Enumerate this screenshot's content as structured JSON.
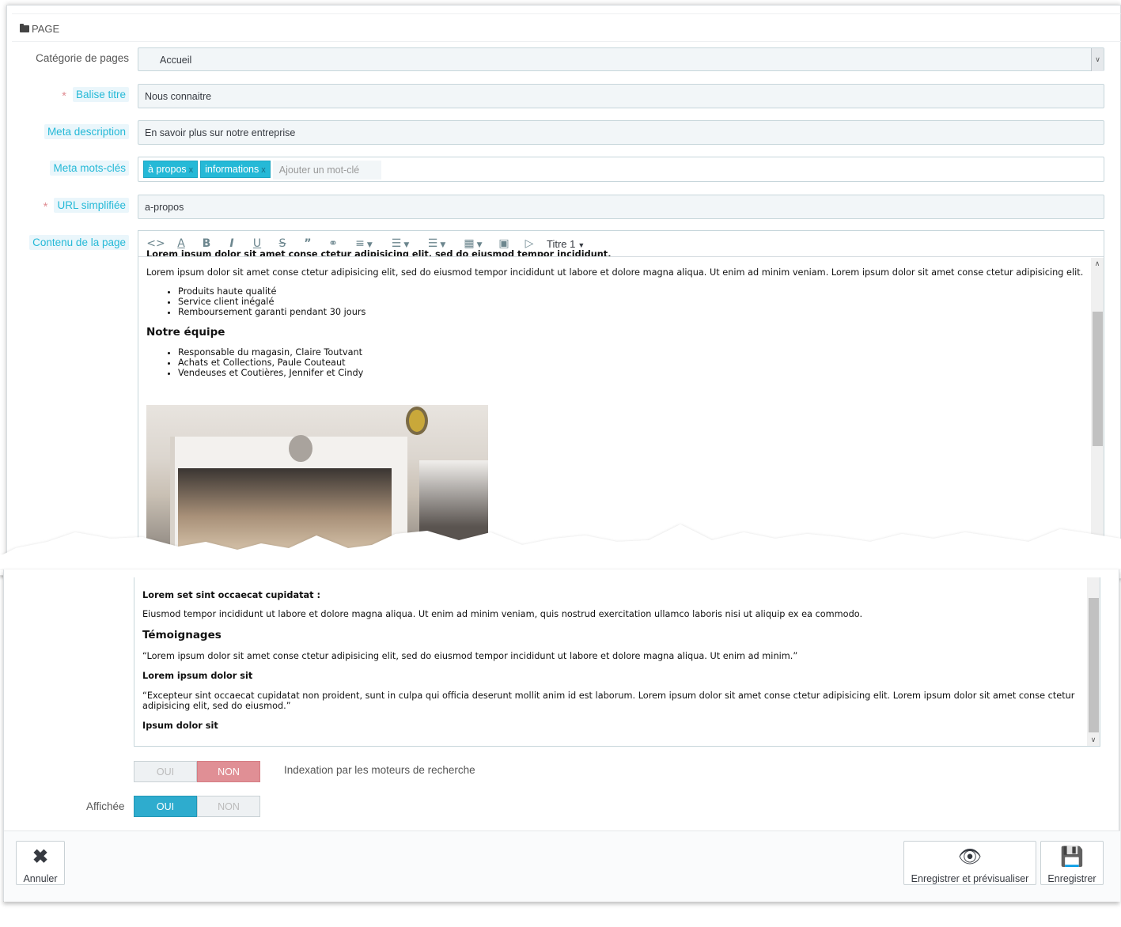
{
  "panel": {
    "title": "PAGE"
  },
  "form": {
    "category_label": "Catégorie de pages",
    "category_value": "Accueil",
    "title_tag_label": "Balise titre",
    "title_tag_value": "Nous connaitre",
    "meta_description_label": "Meta description",
    "meta_description_value": "En savoir plus sur notre entreprise",
    "meta_keywords_label": "Meta mots-clés",
    "keywords": [
      "à propos",
      "informations"
    ],
    "keyword_placeholder": "Ajouter un mot-clé",
    "url_label": "URL simplifiée",
    "url_value": "a-propos",
    "content_label": "Contenu de la page",
    "required_mark": "*"
  },
  "toolbar": {
    "icons": [
      "code-view-icon",
      "text-color-icon",
      "bold-icon",
      "italic-icon",
      "underline-icon",
      "strikethrough-icon",
      "quote-icon",
      "link-icon",
      "align-icon",
      "bullet-list-icon",
      "numbered-list-icon",
      "table-icon",
      "image-icon",
      "video-icon"
    ],
    "heading_select": "Titre 1"
  },
  "content_top": {
    "cut_line": "Lorem ipsum dolor sit amet conse ctetur adipisicing elit, sed do eiusmod tempor incididunt.",
    "paragraph": "Lorem ipsum dolor sit amet conse ctetur adipisicing elit, sed do eiusmod tempor incididunt ut labore et dolore magna aliqua. Ut enim ad minim veniam. Lorem ipsum dolor sit amet conse ctetur adipisicing elit.",
    "list1": [
      "Produits haute qualité",
      "Service client inégalé",
      "Remboursement garanti pendant 30 jours"
    ],
    "heading_team": "Notre équipe",
    "list2": [
      "Responsable du magasin, Claire Toutvant",
      "Achats et Collections, Paule Couteaut",
      "Vendeuses et Coutières, Jennifer et Cindy"
    ]
  },
  "content_bottom": {
    "cut_heading": "Lorem set sint occaecat cupidatat :",
    "paragraph": "Eiusmod tempor incididunt ut labore et dolore magna aliqua. Ut enim ad minim veniam, quis nostrud exercitation ullamco laboris nisi ut aliquip ex ea commodo.",
    "heading_testimonials": "Témoignages",
    "quote1": "“Lorem ipsum dolor sit amet conse ctetur adipisicing elit, sed do eiusmod tempor incididunt ut labore et dolore magna aliqua. Ut enim ad minim.”",
    "author1": "Lorem ipsum dolor sit",
    "quote2": "“Excepteur sint occaecat cupidatat non proident, sunt in culpa qui officia deserunt mollit anim id est laborum. Lorem ipsum dolor sit amet conse ctetur adipisicing elit. Lorem ipsum dolor sit amet conse ctetur adipisicing elit, sed do eiusmod.”",
    "author2": "Ipsum dolor sit"
  },
  "indexation": {
    "oui": "OUI",
    "non": "NON",
    "selected": "NON",
    "note": "Indexation par les moteurs de recherche"
  },
  "displayed": {
    "label": "Affichée",
    "oui": "OUI",
    "non": "NON",
    "selected": "OUI"
  },
  "footer": {
    "cancel": "Annuler",
    "save_preview": "Enregistrer et prévisualiser",
    "save": "Enregistrer"
  },
  "colors": {
    "accent": "#25b9d7",
    "danger_switch": "#e08f95",
    "active_switch": "#2eacce"
  }
}
